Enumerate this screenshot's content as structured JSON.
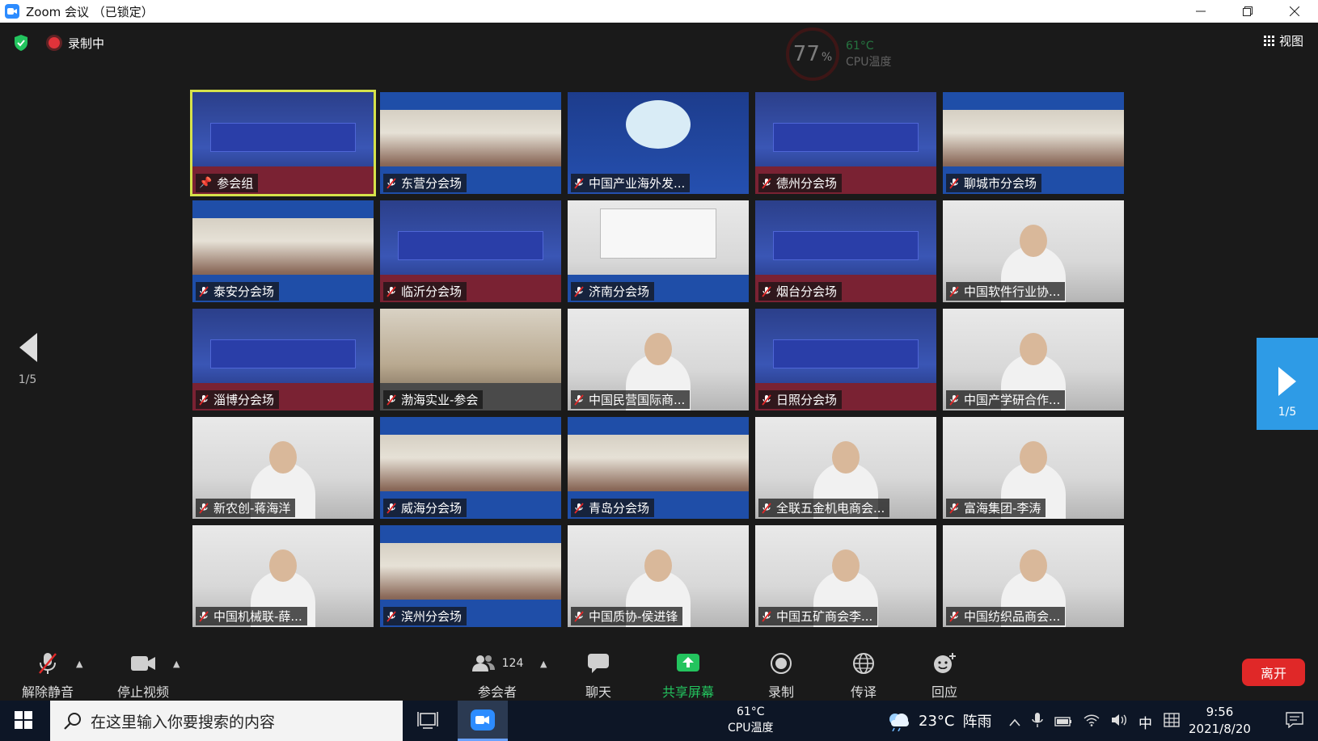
{
  "window": {
    "title": "Zoom 会议  （已锁定）",
    "controls": [
      "minimize",
      "restore",
      "close"
    ]
  },
  "meeting": {
    "recording_label": "录制中",
    "cpu_widget": {
      "percent": "77",
      "percent_unit": "%",
      "temperature": "61°C",
      "label": "CPU温度"
    },
    "view_label": "视图",
    "page_indicator_left": "1/5",
    "page_indicator_right": "1/5"
  },
  "participants": [
    {
      "name": "参会组",
      "scene": "stage",
      "active": true
    },
    {
      "name": "东营分会场",
      "scene": "room"
    },
    {
      "name": "中国产业海外发...",
      "scene": "logo"
    },
    {
      "name": "德州分会场",
      "scene": "stage"
    },
    {
      "name": "聊城市分会场",
      "scene": "room"
    },
    {
      "name": "泰安分会场",
      "scene": "room"
    },
    {
      "name": "临沂分会场",
      "scene": "stage"
    },
    {
      "name": "济南分会场",
      "scene": "white"
    },
    {
      "name": "烟台分会场",
      "scene": "stage"
    },
    {
      "name": "中国软件行业协...",
      "scene": "person"
    },
    {
      "name": "淄博分会场",
      "scene": "stage"
    },
    {
      "name": "渤海实业-参会",
      "scene": "office"
    },
    {
      "name": "中国民营国际商...",
      "scene": "person"
    },
    {
      "name": "日照分会场",
      "scene": "stage"
    },
    {
      "name": "中国产学研合作...",
      "scene": "person"
    },
    {
      "name": "新农创-蒋海洋",
      "scene": "person"
    },
    {
      "name": "威海分会场",
      "scene": "room"
    },
    {
      "name": "青岛分会场",
      "scene": "room"
    },
    {
      "name": "全联五金机电商会...",
      "scene": "person"
    },
    {
      "name": "富海集团-李涛",
      "scene": "person"
    },
    {
      "name": "中国机械联-薛...",
      "scene": "person"
    },
    {
      "name": "滨州分会场",
      "scene": "room"
    },
    {
      "name": "中国质协-侯进锋",
      "scene": "person"
    },
    {
      "name": "中国五矿商会李...",
      "scene": "person"
    },
    {
      "name": "中国纺织品商会...",
      "scene": "person"
    }
  ],
  "toolbar": {
    "unmute": "解除静音",
    "stop_video": "停止视频",
    "participants_label": "参会者",
    "participants_count": "124",
    "chat": "聊天",
    "share_screen": "共享屏幕",
    "record": "录制",
    "interpretation": "传译",
    "reactions": "回应",
    "leave": "离开",
    "share_color": "#23c45e",
    "leave_color": "#e02828"
  },
  "taskbar": {
    "search_placeholder": "在这里输入你要搜索的内容",
    "cpu_temp": "61°C",
    "cpu_label": "CPU温度",
    "weather_temp": "23°C",
    "weather_text": "阵雨",
    "ime": "中",
    "time": "9:56",
    "date": "2021/8/20"
  }
}
